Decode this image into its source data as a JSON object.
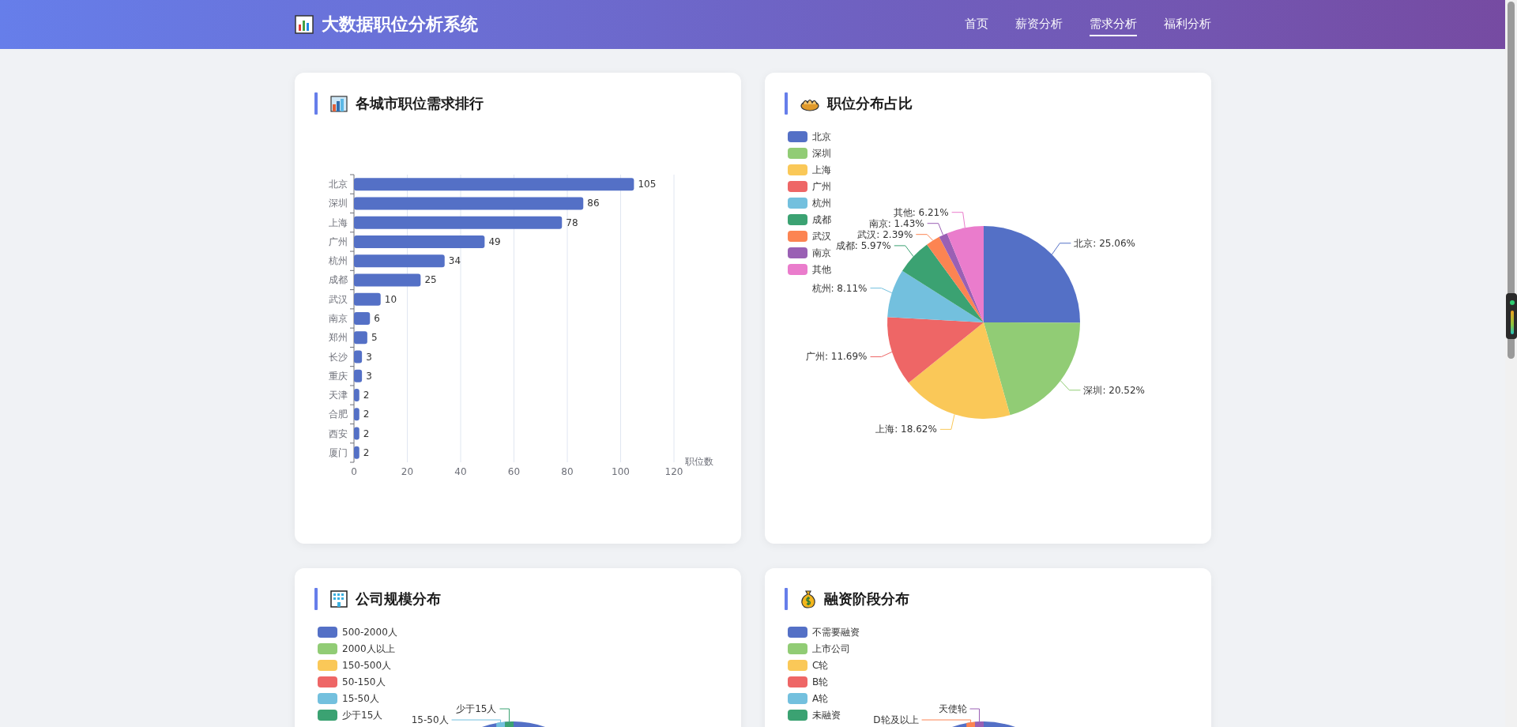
{
  "header": {
    "title": "大数据职位分析系统",
    "nav": [
      {
        "label": "首页",
        "selected": false
      },
      {
        "label": "薪资分析",
        "selected": false
      },
      {
        "label": "需求分析",
        "selected": true
      },
      {
        "label": "福利分析",
        "selected": false
      }
    ]
  },
  "panels": [
    {
      "title": "各城市职位需求排行",
      "chart_data": {
        "type": "bar",
        "orientation": "horizontal",
        "grid": true,
        "categories": [
          "北京",
          "深圳",
          "上海",
          "广州",
          "杭州",
          "成都",
          "武汉",
          "南京",
          "郑州",
          "长沙",
          "重庆",
          "天津",
          "合肥",
          "西安",
          "厦门"
        ],
        "xlabel": "职位数",
        "xlim": [
          0,
          120
        ],
        "xticks": [
          0,
          20,
          40,
          60,
          80,
          100,
          120
        ],
        "data_labels": true,
        "series": [
          {
            "color": "#5470c6",
            "values": [
              105,
              86,
              78,
              49,
              34,
              25,
              10,
              6,
              5,
              3,
              3,
              2,
              2,
              2,
              2
            ]
          }
        ]
      }
    },
    {
      "title": "职位分布占比",
      "chart_data": {
        "type": "pie",
        "categories": [
          "北京",
          "深圳",
          "上海",
          "广州",
          "杭州",
          "成都",
          "武汉",
          "南京",
          "其他"
        ],
        "values": [
          25.06,
          20.52,
          18.62,
          11.69,
          8.11,
          5.97,
          2.39,
          1.43,
          6.21
        ],
        "legend": {
          "items": [
            {
              "color": "#5470c6"
            },
            {
              "color": "#91cc75"
            },
            {
              "color": "#fac858"
            },
            {
              "color": "#ee6666"
            },
            {
              "color": "#73c0de"
            },
            {
              "color": "#3ba272"
            },
            {
              "color": "#fc8452"
            },
            {
              "color": "#9a60b4"
            },
            {
              "color": "#ea7ccc"
            }
          ]
        },
        "value_labels": [
          "北京: 25.06%",
          "深圳: 20.52%",
          "上海: 18.62%",
          "广州: 11.69%",
          "杭州: 8.11%",
          "成都: 5.97%",
          "武汉: 2.39%",
          "南京: 1.43%",
          "其他: 6.21%"
        ]
      }
    },
    {
      "title": "公司规模分布",
      "kind": "partial_pie",
      "legend": [
        {
          "label": "500-2000人",
          "color": "#5470c6"
        },
        {
          "label": "2000人以上",
          "color": "#91cc75"
        },
        {
          "label": "150-500人",
          "color": "#fac858"
        },
        {
          "label": "50-150人",
          "color": "#ee6666"
        },
        {
          "label": "15-50人",
          "color": "#73c0de"
        },
        {
          "label": "少于15人",
          "color": "#3ba272"
        }
      ],
      "callouts": [
        {
          "text": "少于15人",
          "color": "#3ba272"
        },
        {
          "text": "15-50人",
          "color": "#73c0de"
        }
      ]
    },
    {
      "title": "融资阶段分布",
      "kind": "partial_pie",
      "legend": [
        {
          "label": "不需要融资",
          "color": "#5470c6"
        },
        {
          "label": "上市公司",
          "color": "#91cc75"
        },
        {
          "label": "C轮",
          "color": "#fac858"
        },
        {
          "label": "B轮",
          "color": "#ee6666"
        },
        {
          "label": "A轮",
          "color": "#73c0de"
        },
        {
          "label": "未融资",
          "color": "#3ba272"
        }
      ],
      "callouts": [
        {
          "text": "天使轮",
          "color": "#9a60b4"
        },
        {
          "text": "D轮及以上",
          "color": "#fc8452"
        }
      ]
    }
  ]
}
